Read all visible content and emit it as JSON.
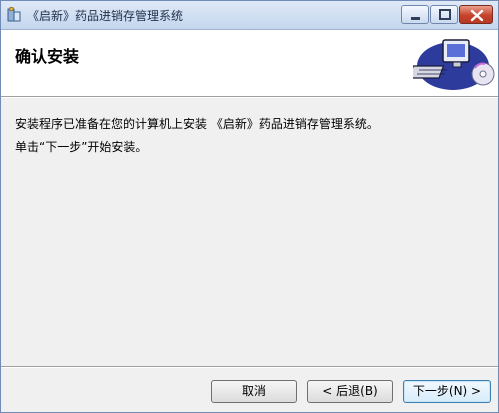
{
  "window": {
    "title": "《启新》药品进销存管理系统"
  },
  "header": {
    "title": "确认安装",
    "art_icon": "computer-cd-icon"
  },
  "content": {
    "line1": "安装程序已准备在您的计算机上安装 《启新》药品进销存管理系统。",
    "line2": "单击“下一步”开始安装。"
  },
  "buttons": {
    "cancel": "取消",
    "back": "< 后退(B)",
    "next": "下一步(N) >"
  },
  "colors": {
    "title_bar": "#c4d6ee",
    "close_button": "#c6432b",
    "background": "#f0f0f0",
    "default_button_border": "#3c7fb1"
  }
}
